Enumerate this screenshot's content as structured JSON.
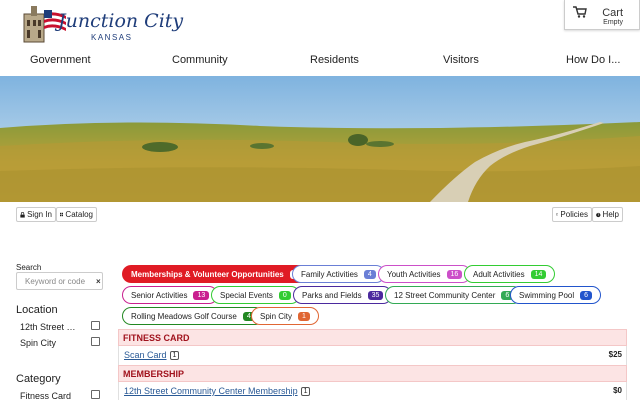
{
  "header": {
    "logo_title": "Junction City",
    "logo_subtitle": "KANSAS",
    "cart_label": "Cart",
    "cart_status": "Empty"
  },
  "nav": [
    "Government",
    "Community",
    "Residents",
    "Visitors",
    "How Do I..."
  ],
  "toolbar": {
    "sign_in": "Sign In",
    "catalog": "Catalog",
    "policies": "Policies",
    "help": "Help"
  },
  "sidebar": {
    "search_label": "Search",
    "search_placeholder": "Keyword or code",
    "location_heading": "Location",
    "locations": [
      "12th Street Co...",
      "Spin City"
    ],
    "category_heading": "Category",
    "categories": [
      "Fitness Card"
    ]
  },
  "filters": [
    {
      "label": "Memberships & Volunteer Opportunities",
      "count": "7",
      "active": true,
      "color": "#e01b24"
    },
    {
      "label": "Family Activities",
      "count": "4",
      "color": "#6a7fd6"
    },
    {
      "label": "Youth Activities",
      "count": "16",
      "color": "#cc4fc9"
    },
    {
      "label": "Adult Activities",
      "count": "14",
      "color": "#33cc33"
    },
    {
      "label": "Senior Activities",
      "count": "13",
      "color": "#c91f8f"
    },
    {
      "label": "Special Events",
      "count": "0",
      "color": "#33cc33"
    },
    {
      "label": "Parks and Fields",
      "count": "35",
      "color": "#4b2a9e"
    },
    {
      "label": "12 Street Community Center",
      "count": "6",
      "color": "#33aa55"
    },
    {
      "label": "Swimming Pool",
      "count": "6",
      "color": "#2255cc"
    },
    {
      "label": "Rolling Meadows Golf Course",
      "count": "4",
      "color": "#228822"
    },
    {
      "label": "Spin City",
      "count": "1",
      "color": "#e06633"
    }
  ],
  "sections": [
    {
      "title": "FITNESS CARD",
      "items": [
        {
          "name": "Scan Card",
          "qty": "1",
          "price": "$25"
        }
      ]
    },
    {
      "title": "MEMBERSHIP",
      "items": [
        {
          "name": "12th Street Community Center Membership",
          "qty": "1",
          "price": "$0"
        }
      ]
    }
  ],
  "colors": {
    "brand_blue": "#1f3d7a",
    "accent_red": "#e01b24",
    "section_bg": "#fce4e4"
  }
}
